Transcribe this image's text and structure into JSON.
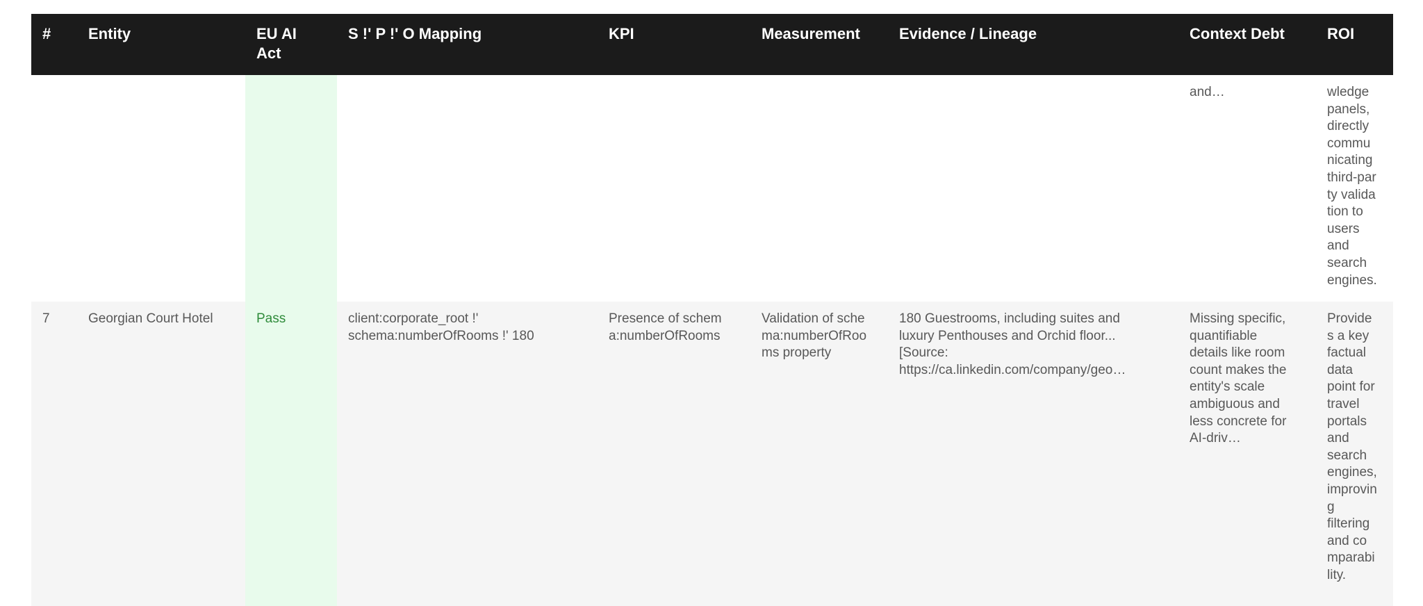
{
  "table": {
    "headers": [
      "#",
      "Entity",
      "EU AI Act",
      "S !' P !' O Mapping",
      "KPI",
      "Measurement",
      "Evidence / Lineage",
      "Context Debt",
      "ROI"
    ],
    "row_partial": {
      "context_debt": "and…",
      "roi_lines": [
        "wledge",
        "panels,",
        "directly",
        "commu",
        "nicating",
        "third-par",
        "ty valida",
        "tion to",
        "users",
        "and",
        "search",
        "engines."
      ]
    },
    "row_7": {
      "index": "7",
      "entity": "Georgian Court Hotel",
      "eu_ai_act": "Pass",
      "mapping_lines": [
        "client:corporate_root !'",
        "schema:numberOfRooms !' 180"
      ],
      "kpi_lines": [
        "Presence of schem",
        "a:numberOfRooms"
      ],
      "measurement_lines": [
        "Validation of sche",
        "ma:numberOfRoo",
        "ms property"
      ],
      "evidence_lines": [
        "180 Guestrooms, including suites and",
        "luxury Penthouses and Orchid floor...",
        "[Source:",
        "https://ca.linkedin.com/company/geo…"
      ],
      "context_debt_lines": [
        "Missing specific,",
        "quantifiable",
        "details like room",
        "count makes the",
        "entity's scale",
        "ambiguous and",
        "less concrete for",
        "AI-driv…"
      ],
      "roi_lines": [
        "Provide",
        "s a key",
        "factual",
        "data",
        "point for",
        "travel",
        "portals",
        "and",
        "search",
        "engines,",
        "improvin",
        "g",
        "filtering",
        "and co",
        "mparabi",
        "lity."
      ]
    }
  }
}
